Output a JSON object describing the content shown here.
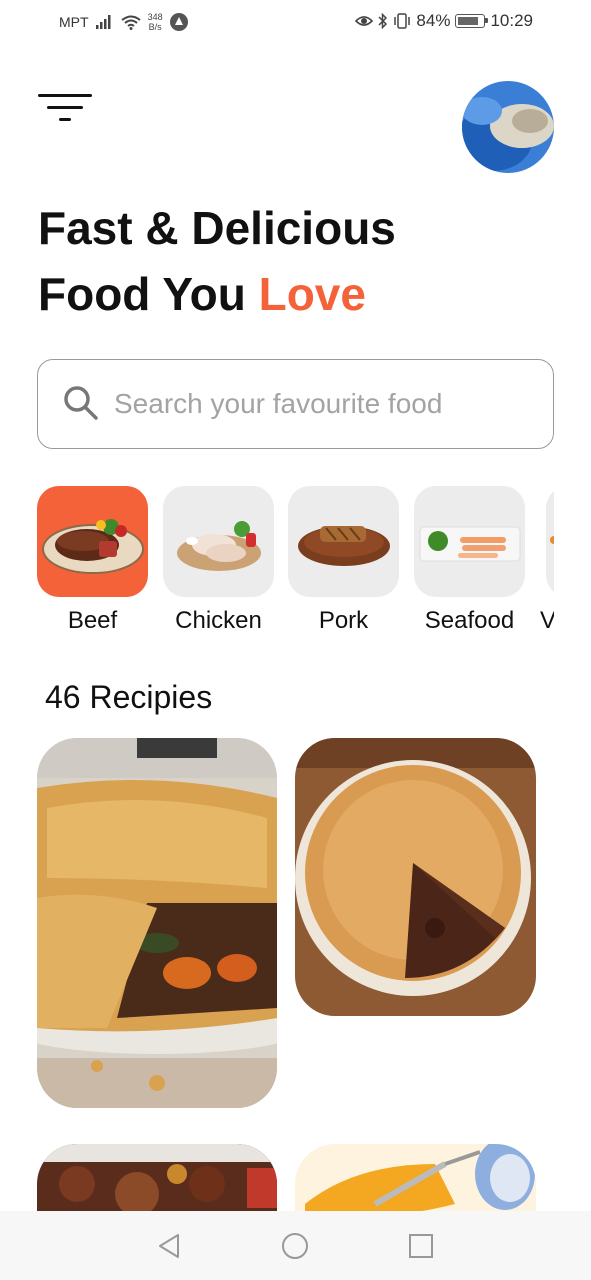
{
  "status_bar": {
    "carrier": "MPT",
    "net_speed_value": "348",
    "net_speed_unit": "B/s",
    "battery": "84%",
    "time": "10:29"
  },
  "header": {
    "menu_icon": "filter-menu-icon",
    "avatar": "user-avatar"
  },
  "headline": {
    "line1": "Fast & Delicious",
    "line2_prefix": "Food You ",
    "line2_accent": "Love",
    "accent_color": "#f4623a"
  },
  "search": {
    "placeholder": "Search your favourite food",
    "value": ""
  },
  "categories": [
    {
      "label": "Beef",
      "active": true
    },
    {
      "label": "Chicken",
      "active": false
    },
    {
      "label": "Pork",
      "active": false
    },
    {
      "label": "Seafood",
      "active": false
    },
    {
      "label": "V",
      "active": false
    }
  ],
  "recipes": {
    "title": "46 Recipies"
  },
  "nav": {
    "back": "back-icon",
    "home": "home-icon",
    "recents": "recents-icon"
  }
}
